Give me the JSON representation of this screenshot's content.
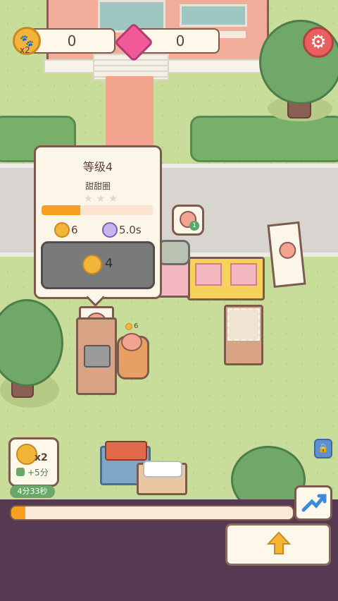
{
  "hud": {
    "coin_multiplier": "x2",
    "coin_count": "0",
    "gem_count": "0",
    "settings_icon": "gear-icon"
  },
  "popup": {
    "level": "等级4",
    "item_name": "甜甜圈",
    "stars_total": 3,
    "progress": 0.35,
    "income": "6",
    "time": "5.0s",
    "upgrade_cost": "4"
  },
  "scene": {
    "customer_badge": "1",
    "counter_income": "6"
  },
  "boost": {
    "multiplier": "x2",
    "plus_time": "+5分",
    "remaining": "4分33秒"
  },
  "bottom": {
    "progress": 0.05,
    "trend_icon": "trending-up-icon",
    "upgrade_icon": "arrow-up-icon"
  },
  "colors": {
    "accent": "#f7a01e",
    "coin": "#f2b53a",
    "gem": "#f05a99",
    "panel": "#563a51"
  }
}
